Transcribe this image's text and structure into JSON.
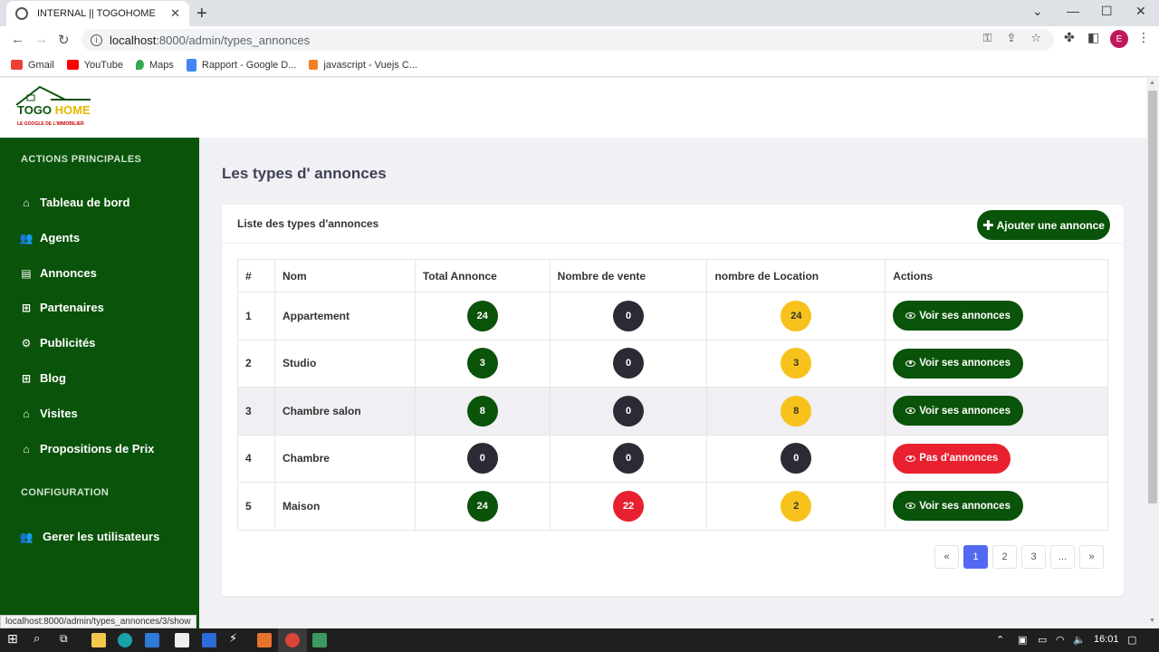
{
  "browser": {
    "tab_title": "INTERNAL || TOGOHOME",
    "url_host": "localhost",
    "url_path": ":8000/admin/types_annonces",
    "profile_initial": "E",
    "bookmarks": [
      {
        "label": "Gmail",
        "color": "#ea4335"
      },
      {
        "label": "YouTube",
        "color": "#ff0000"
      },
      {
        "label": "Maps",
        "color": "#34a853"
      },
      {
        "label": "Rapport - Google D...",
        "color": "#4285f4"
      },
      {
        "label": "javascript - Vuejs C...",
        "color": "#f48024"
      }
    ],
    "status_url": "localhost:8000/admin/types_annonces/3/show"
  },
  "logo": {
    "title_part1": "TOGO",
    "title_part2": " HOME",
    "tagline": "LE GOOGLE DE L'IMMOBILIER"
  },
  "sidebar": {
    "section_main": "ACTIONS PRINCIPALES",
    "items": [
      {
        "label": "Tableau de bord",
        "icon": "home-icon"
      },
      {
        "label": "Agents",
        "icon": "users-icon"
      },
      {
        "label": "Annonces",
        "icon": "list-icon"
      },
      {
        "label": "Partenaires",
        "icon": "grid-icon"
      },
      {
        "label": "Publicités",
        "icon": "gear-icon"
      },
      {
        "label": "Blog",
        "icon": "grid-icon"
      },
      {
        "label": "Visites",
        "icon": "home-icon"
      },
      {
        "label": "Propositions de Prix",
        "icon": "home-icon"
      }
    ],
    "section_config": "CONFIGURATION",
    "config_items": [
      {
        "label": "Gerer les utilisateurs",
        "icon": "users-icon"
      }
    ]
  },
  "page": {
    "title": "Les types d' annonces",
    "card_title": "Liste des types d'annonces",
    "add_button": "Ajouter une annonce"
  },
  "table": {
    "headers": [
      "#",
      "Nom",
      "Total Annonce",
      "Nombre de vente",
      "nombre de Location",
      "Actions"
    ],
    "rows": [
      {
        "id": "1",
        "nom": "Appartement",
        "total": "24",
        "vente": "0",
        "location": "24",
        "action": "Voir ses annonces"
      },
      {
        "id": "2",
        "nom": "Studio",
        "total": "3",
        "vente": "0",
        "location": "3",
        "action": "Voir ses annonces"
      },
      {
        "id": "3",
        "nom": "Chambre salon",
        "total": "8",
        "vente": "0",
        "location": "8",
        "action": "Voir ses annonces"
      },
      {
        "id": "4",
        "nom": "Chambre",
        "total": "0",
        "vente": "0",
        "location": "0",
        "action": "Pas d'annonces"
      },
      {
        "id": "5",
        "nom": "Maison",
        "total": "24",
        "vente": "22",
        "location": "2",
        "action": "Voir ses annonces"
      }
    ]
  },
  "pagination": [
    "«",
    "1",
    "2",
    "3",
    "...",
    "»"
  ],
  "taskbar": {
    "time": "16:01"
  },
  "colors": {
    "brand_green": "#0a530a",
    "accent_yellow": "#f7c21b",
    "danger_red": "#e8202f",
    "pager_active": "#5469f2"
  }
}
